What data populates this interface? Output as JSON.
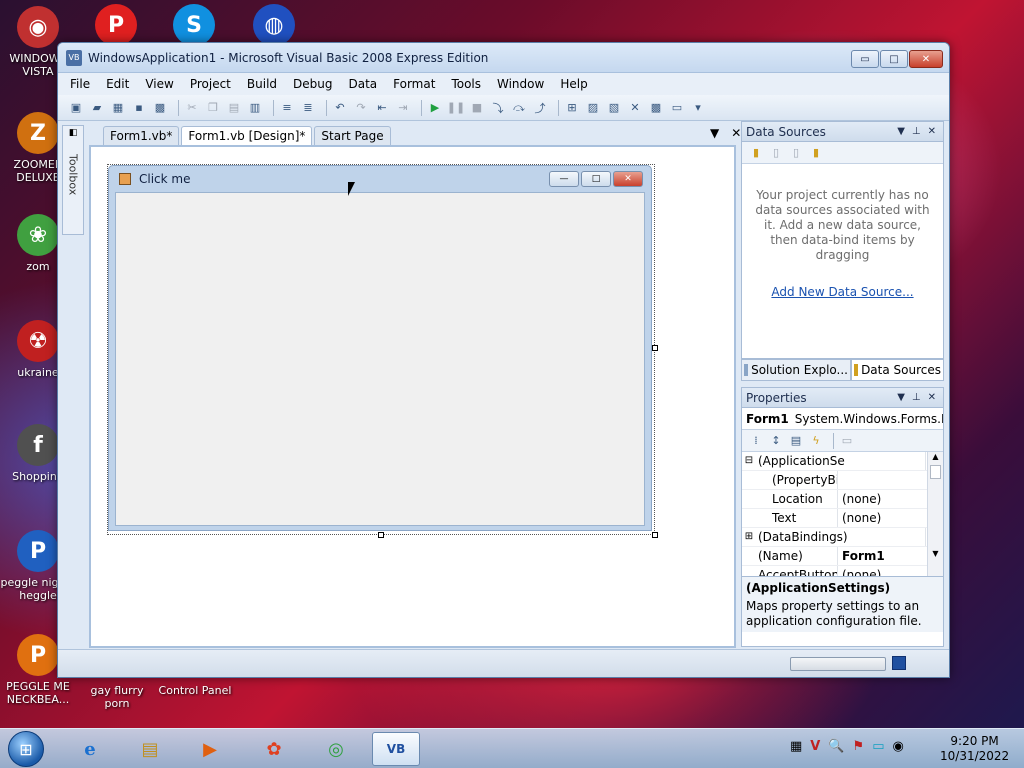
{
  "desktop": {
    "icons": [
      {
        "label": "WINDOWS VISTA",
        "glyph": "◉",
        "color": "#c03030"
      },
      {
        "label": "ZOOMER DELUXE",
        "glyph": "Z",
        "color": "#d07010"
      },
      {
        "label": "zom",
        "glyph": "❀",
        "color": "#40a040"
      },
      {
        "label": "ukraine",
        "glyph": "☢",
        "color": "#c02020"
      },
      {
        "label": "Shopping",
        "glyph": "f",
        "color": "#505050"
      },
      {
        "label": "peggle nights heggle",
        "glyph": "P",
        "color": "#2060c0"
      },
      {
        "label": "PEGGLE ME NECKBEA...",
        "glyph": "P",
        "color": "#e07010"
      },
      {
        "label": "gay flurry porn",
        "glyph": "",
        "color": "transparent"
      },
      {
        "label": "Control Panel",
        "glyph": "",
        "color": "transparent"
      },
      {
        "label": "",
        "glyph": "P",
        "color": "#e02020"
      },
      {
        "label": "",
        "glyph": "S",
        "color": "#1090e0"
      },
      {
        "label": "",
        "glyph": "◍",
        "color": "#2050c0"
      }
    ]
  },
  "window": {
    "title": "WindowsApplication1 - Microsoft Visual Basic 2008 Express Edition",
    "app_icon": "VB",
    "minimize": "▭",
    "maximize": "□",
    "close": "✕"
  },
  "menu": [
    "File",
    "Edit",
    "View",
    "Project",
    "Build",
    "Debug",
    "Data",
    "Format",
    "Tools",
    "Window",
    "Help"
  ],
  "toolbox": {
    "label": "Toolbox",
    "pin": "◧"
  },
  "tabs": [
    {
      "label": "Form1.vb*",
      "active": false
    },
    {
      "label": "Form1.vb [Design]*",
      "active": true
    },
    {
      "label": "Start Page",
      "active": false
    }
  ],
  "tab_controls": {
    "dropdown": "▼",
    "close": "✕"
  },
  "form": {
    "title": "Click me",
    "minimize": "—",
    "maximize": "□",
    "close": "✕"
  },
  "data_sources": {
    "header": "Data Sources",
    "message": "Your project currently has no data sources associated with it. Add a new data source, then data-bind items by dragging",
    "link": "Add New Data Source..."
  },
  "panel_tabs": {
    "solution": "Solution Explo...",
    "data": "Data Sources"
  },
  "properties": {
    "header": "Properties",
    "object_name": "Form1",
    "object_type": "System.Windows.Forms.Fo",
    "rows": [
      {
        "expander": "⊟",
        "name": "(ApplicationSe",
        "value": "",
        "indent": false,
        "bold": false
      },
      {
        "expander": "",
        "name": "(PropertyBir",
        "value": "",
        "indent": true,
        "bold": false
      },
      {
        "expander": "",
        "name": "Location",
        "value": "(none)",
        "indent": true,
        "bold": false
      },
      {
        "expander": "",
        "name": "Text",
        "value": "(none)",
        "indent": true,
        "bold": false
      },
      {
        "expander": "⊞",
        "name": "(DataBindings)",
        "value": "",
        "indent": false,
        "bold": false
      },
      {
        "expander": "",
        "name": "(Name)",
        "value": "Form1",
        "indent": false,
        "bold": true
      },
      {
        "expander": "",
        "name": "AcceptButton",
        "value": "(none)",
        "indent": false,
        "bold": false
      }
    ],
    "desc_title": "(ApplicationSettings)",
    "desc_text": "Maps property settings to an application configuration file."
  },
  "taskbar": {
    "start": "⊞",
    "apps": [
      {
        "icon": "e",
        "name": "internet-explorer"
      },
      {
        "icon": "▤",
        "name": "explorer"
      },
      {
        "icon": "▶",
        "name": "media-player"
      },
      {
        "icon": "✿",
        "name": "app"
      },
      {
        "icon": "◎",
        "name": "chrome"
      },
      {
        "icon": "VB",
        "name": "visual-basic"
      }
    ],
    "tray": [
      "▦",
      "V",
      "🔍",
      "⚑",
      "▭",
      "◉"
    ],
    "time": "9:20 PM",
    "date": "10/31/2022"
  }
}
